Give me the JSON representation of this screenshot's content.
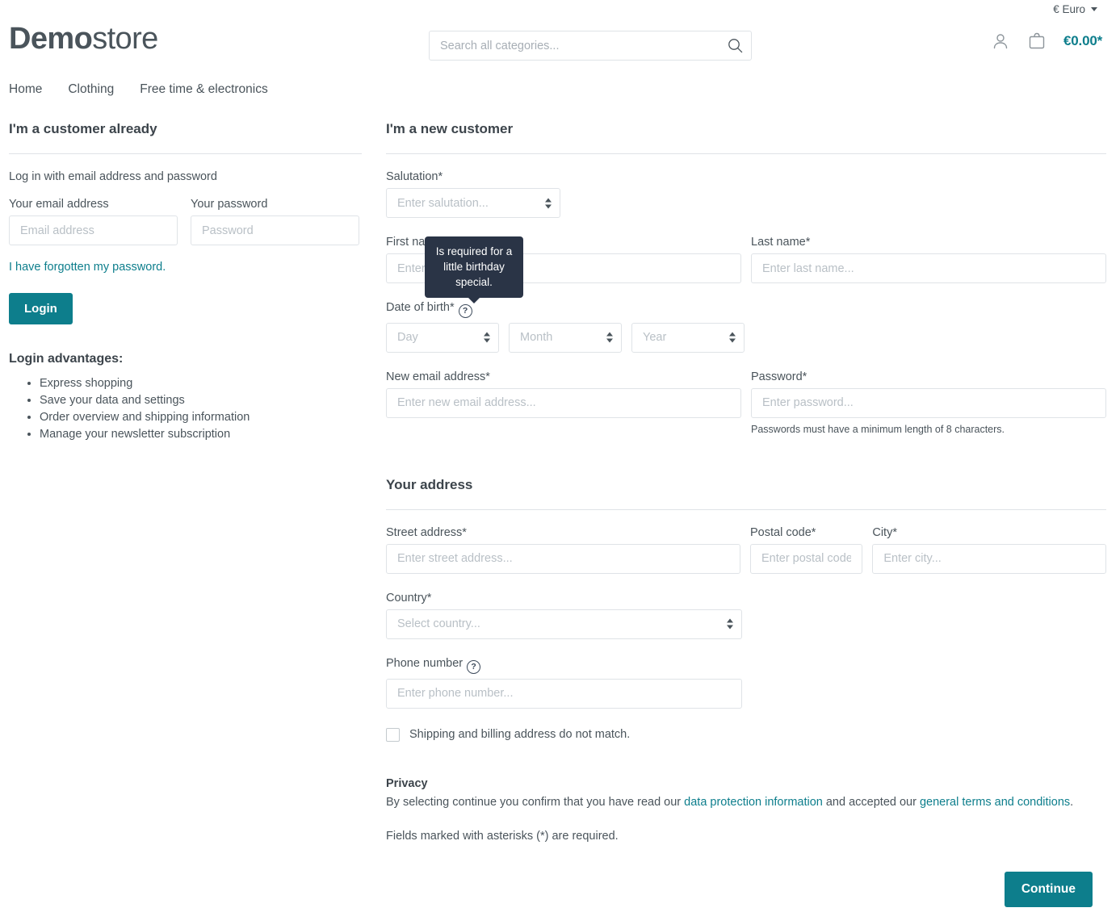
{
  "utility": {
    "currency_label": "€ Euro"
  },
  "header": {
    "logo_bold": "Demo",
    "logo_light": "store",
    "search_placeholder": "Search all categories...",
    "search_value": "",
    "cart_total": "€0.00*"
  },
  "nav": {
    "items": [
      {
        "label": "Home"
      },
      {
        "label": "Clothing"
      },
      {
        "label": "Free time & electronics"
      }
    ]
  },
  "login": {
    "title": "I'm a customer already",
    "subtitle": "Log in with email address and password",
    "email_label": "Your email address",
    "email_placeholder": "Email address",
    "email_value": "",
    "password_label": "Your password",
    "password_placeholder": "Password",
    "password_value": "",
    "forgot_link": "I have forgotten my password.",
    "login_button": "Login",
    "advantages_title": "Login advantages:",
    "advantages": [
      "Express shopping",
      "Save your data and settings",
      "Order overview and shipping information",
      "Manage your newsletter subscription"
    ]
  },
  "register": {
    "title": "I'm a new customer",
    "salutation_label": "Salutation*",
    "salutation_placeholder": "Enter salutation...",
    "first_name_label": "First name*",
    "first_name_placeholder": "Enter first name...",
    "last_name_label": "Last name*",
    "last_name_placeholder": "Enter last name...",
    "dob_label": "Date of birth*",
    "dob_day_placeholder": "Day",
    "dob_month_placeholder": "Month",
    "dob_year_placeholder": "Year",
    "email_label": "New email address*",
    "email_placeholder": "Enter new email address...",
    "password_label": "Password*",
    "password_placeholder": "Enter password...",
    "password_hint": "Passwords must have a minimum length of 8 characters.",
    "help_glyph": "?"
  },
  "address": {
    "title": "Your address",
    "street_label": "Street address*",
    "street_placeholder": "Enter street address...",
    "postal_label": "Postal code*",
    "postal_placeholder": "Enter postal code.",
    "city_label": "City*",
    "city_placeholder": "Enter city...",
    "country_label": "Country*",
    "country_placeholder": "Select country...",
    "phone_label": "Phone number",
    "phone_placeholder": "Enter phone number...",
    "different_shipping_label": "Shipping and billing address do not match."
  },
  "privacy": {
    "title": "Privacy",
    "text_before": "By selecting continue you confirm that you have read our ",
    "link_data_protection": "data protection information",
    "text_middle": " and accepted our ",
    "link_terms": "general terms and conditions",
    "text_after": ".",
    "required_note": "Fields marked with asterisks (*) are required."
  },
  "actions": {
    "continue_label": "Continue"
  },
  "tooltip": {
    "text": "Is required for a little birthday special."
  },
  "colors": {
    "accent_teal": "#0d7e8c",
    "text": "#4a545b",
    "heading": "#3c444b",
    "border": "#dfe3e7",
    "tooltip_bg": "#2a3446"
  }
}
